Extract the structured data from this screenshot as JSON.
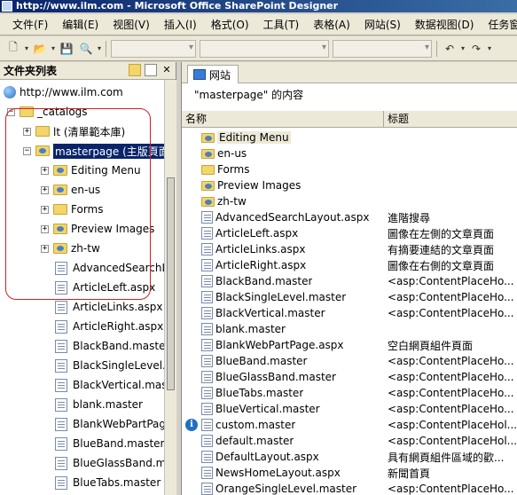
{
  "window": {
    "title": "http://www.ilm.com - Microsoft Office SharePoint Designer"
  },
  "menu": [
    "文件(F)",
    "编辑(E)",
    "视图(V)",
    "插入(I)",
    "格式(O)",
    "工具(T)",
    "表格(A)",
    "网站(S)",
    "数据视图(D)",
    "任务窗格(K)"
  ],
  "left_pane": {
    "title": "文件夹列表",
    "tree": [
      {
        "label": "http://www.ilm.com",
        "level": 0,
        "icon": "globe-icon",
        "expander": ""
      },
      {
        "label": "_catalogs",
        "level": 1,
        "icon": "folder-icon",
        "expander": "−"
      },
      {
        "label": "lt (清單範本庫)",
        "level": 2,
        "icon": "folder-icon",
        "expander": "+"
      },
      {
        "label": "masterpage (主版頁面",
        "level": 2,
        "icon": "folder-web-icon",
        "expander": "−",
        "selected": true
      },
      {
        "label": "Editing Menu",
        "level": 3,
        "icon": "folder-web-icon",
        "expander": "+"
      },
      {
        "label": "en-us",
        "level": 3,
        "icon": "folder-web-icon",
        "expander": "+"
      },
      {
        "label": "Forms",
        "level": 3,
        "icon": "folder-icon",
        "expander": "+"
      },
      {
        "label": "Preview Images",
        "level": 3,
        "icon": "folder-web-icon",
        "expander": "+"
      },
      {
        "label": "zh-tw",
        "level": 3,
        "icon": "folder-web-icon",
        "expander": "+"
      },
      {
        "label": "AdvancedSearchL",
        "level": 3,
        "icon": "file-icon",
        "expander": ""
      },
      {
        "label": "ArticleLeft.aspx",
        "level": 3,
        "icon": "file-icon",
        "expander": ""
      },
      {
        "label": "ArticleLinks.aspx",
        "level": 3,
        "icon": "file-icon",
        "expander": ""
      },
      {
        "label": "ArticleRight.aspx",
        "level": 3,
        "icon": "file-icon",
        "expander": ""
      },
      {
        "label": "BlackBand.master",
        "level": 3,
        "icon": "file-icon",
        "expander": ""
      },
      {
        "label": "BlackSingleLevel.r",
        "level": 3,
        "icon": "file-icon",
        "expander": ""
      },
      {
        "label": "BlackVertical.mast",
        "level": 3,
        "icon": "file-icon",
        "expander": ""
      },
      {
        "label": "blank.master",
        "level": 3,
        "icon": "file-icon",
        "expander": ""
      },
      {
        "label": "BlankWebPartPag",
        "level": 3,
        "icon": "file-icon",
        "expander": ""
      },
      {
        "label": "BlueBand.master",
        "level": 3,
        "icon": "file-icon",
        "expander": ""
      },
      {
        "label": "BlueGlassBand.m",
        "level": 3,
        "icon": "file-icon",
        "expander": ""
      },
      {
        "label": "BlueTabs.master",
        "level": 3,
        "icon": "file-icon",
        "expander": ""
      }
    ]
  },
  "right_pane": {
    "tab_label": "网站",
    "content_title": "\"masterpage\" 的内容",
    "columns": [
      "名称",
      "标题"
    ],
    "rows": [
      {
        "name": "Editing Menu",
        "title": "",
        "icon": "folder-web-icon",
        "highlight": true
      },
      {
        "name": "en-us",
        "title": "",
        "icon": "folder-web-icon"
      },
      {
        "name": "Forms",
        "title": "",
        "icon": "folder-icon"
      },
      {
        "name": "Preview Images",
        "title": "",
        "icon": "folder-web-icon"
      },
      {
        "name": "zh-tw",
        "title": "",
        "icon": "folder-web-icon"
      },
      {
        "name": "AdvancedSearchLayout.aspx",
        "title": "進階搜尋",
        "icon": "file-icon"
      },
      {
        "name": "ArticleLeft.aspx",
        "title": "圖像在左側的文章頁面",
        "icon": "file-icon"
      },
      {
        "name": "ArticleLinks.aspx",
        "title": "有摘要連結的文章頁面",
        "icon": "file-icon"
      },
      {
        "name": "ArticleRight.aspx",
        "title": "圖像在右側的文章頁面",
        "icon": "file-icon"
      },
      {
        "name": "BlackBand.master",
        "title": "<asp:ContentPlaceHo...",
        "icon": "file-icon"
      },
      {
        "name": "BlackSingleLevel.master",
        "title": "<asp:ContentPlaceHo...",
        "icon": "file-icon"
      },
      {
        "name": "BlackVertical.master",
        "title": "<asp:ContentPlaceHo...",
        "icon": "file-icon"
      },
      {
        "name": "blank.master",
        "title": "",
        "icon": "file-icon"
      },
      {
        "name": "BlankWebPartPage.aspx",
        "title": "空白網頁組件頁面",
        "icon": "file-icon"
      },
      {
        "name": "BlueBand.master",
        "title": "<asp:ContentPlaceHo...",
        "icon": "file-icon"
      },
      {
        "name": "BlueGlassBand.master",
        "title": "<asp:ContentPlaceHo...",
        "icon": "file-icon"
      },
      {
        "name": "BlueTabs.master",
        "title": "<asp:ContentPlaceHo...",
        "icon": "file-icon"
      },
      {
        "name": "BlueVertical.master",
        "title": "<asp:ContentPlaceHo...",
        "icon": "file-icon"
      },
      {
        "name": "custom.master",
        "title": "<asp:ContentPlaceHol...",
        "icon": "file-icon",
        "info": true
      },
      {
        "name": "default.master",
        "title": "<asp:ContentPlaceHol...",
        "icon": "file-icon"
      },
      {
        "name": "DefaultLayout.aspx",
        "title": "具有網頁組件區域的歡...",
        "icon": "file-icon"
      },
      {
        "name": "NewsHomeLayout.aspx",
        "title": "新聞首頁",
        "icon": "file-icon"
      },
      {
        "name": "OrangeSingleLevel.master",
        "title": "<asp:ContentPlaceHo...",
        "icon": "file-icon"
      }
    ]
  },
  "colors": {
    "title_bar": "#0a246a",
    "selection": "#0a246a",
    "annotation": "#d02020"
  }
}
